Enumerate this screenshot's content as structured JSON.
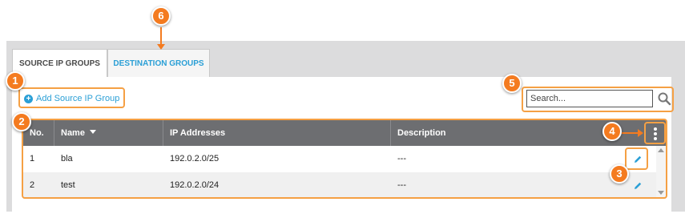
{
  "tabs": [
    {
      "label": "SOURCE IP GROUPS",
      "active": true
    },
    {
      "label": "DESTINATION GROUPS",
      "active": false
    }
  ],
  "toolbar": {
    "add_label": "Add Source IP Group"
  },
  "search": {
    "placeholder": "Search..."
  },
  "table": {
    "columns": [
      "No.",
      "Name",
      "IP Addresses",
      "Description"
    ],
    "sort_column": "Name",
    "rows": [
      {
        "no": "1",
        "name": "bla",
        "ip": "192.0.2.0/25",
        "description": "---"
      },
      {
        "no": "2",
        "name": "test",
        "ip": "192.0.2.0/24",
        "description": "---"
      }
    ]
  },
  "callouts": [
    "1",
    "2",
    "3",
    "4",
    "5",
    "6"
  ],
  "colors": {
    "accent": "#2a9fd6",
    "header_bg": "#6d6e71",
    "callout": "#f47b20",
    "highlight": "#f5a044"
  }
}
